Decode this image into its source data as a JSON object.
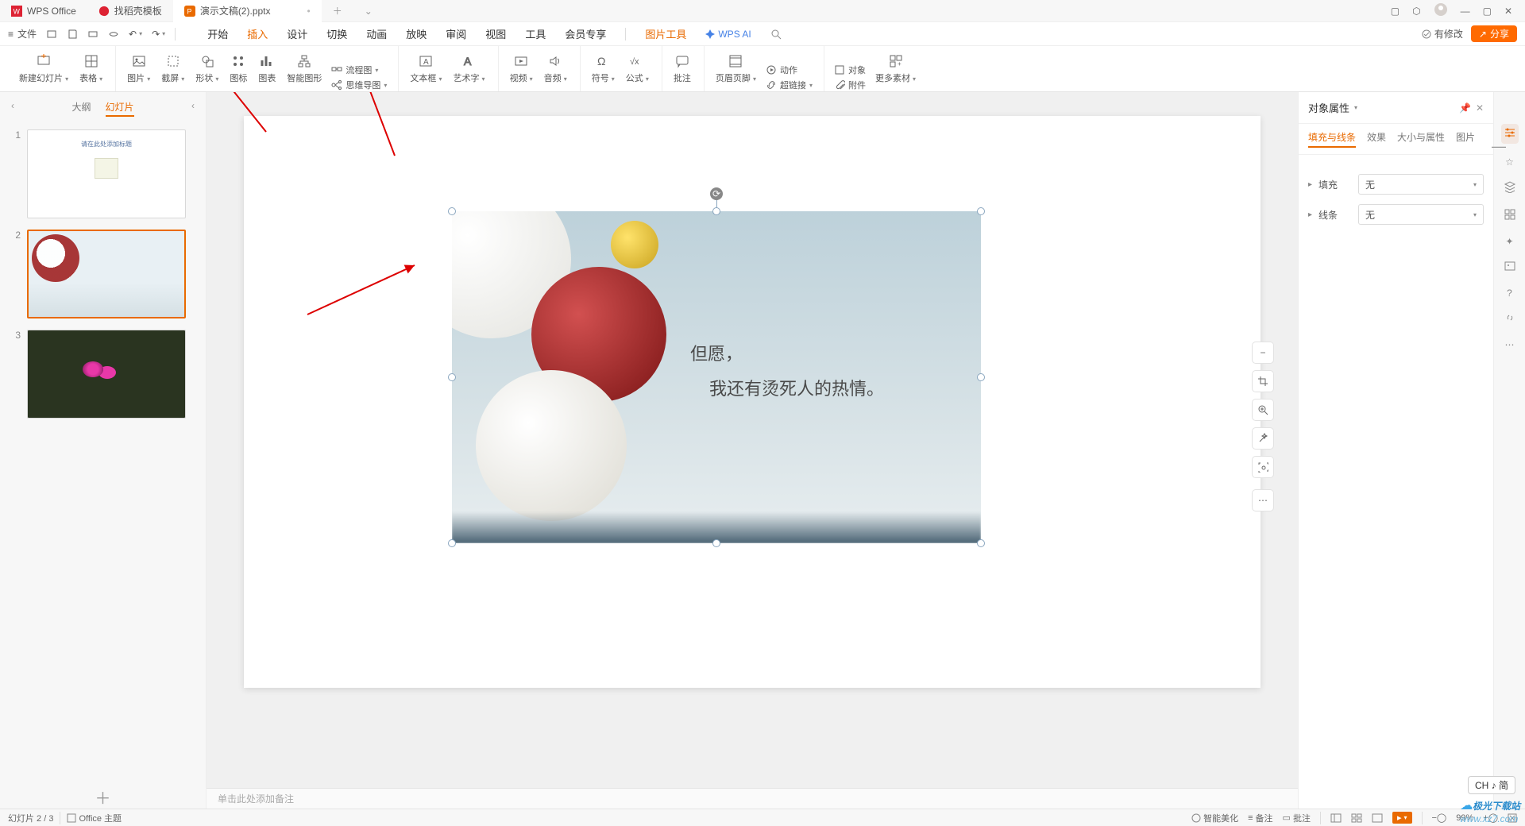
{
  "titlebar": {
    "tabs": [
      {
        "label": "WPS Office",
        "brand": "wps"
      },
      {
        "label": "找稻壳模板",
        "brand": "dao"
      },
      {
        "label": "演示文稿(2).pptx",
        "brand": "ppt",
        "active": true
      }
    ]
  },
  "qtoolbar": {
    "file_label": "文件",
    "right": {
      "changes": "有修改",
      "share": "分享"
    }
  },
  "menubar": {
    "items": [
      "开始",
      "插入",
      "设计",
      "切换",
      "动画",
      "放映",
      "审阅",
      "视图",
      "工具",
      "会员专享"
    ],
    "active_index": 1,
    "extra": "图片工具",
    "ai": "WPS AI"
  },
  "ribbon": {
    "btns": [
      "新建幻灯片",
      "表格",
      "图片",
      "截屏",
      "形状",
      "图标",
      "图表",
      "智能图形",
      "流程图",
      "思维导图",
      "文本框",
      "艺术字",
      "视频",
      "音频",
      "符号",
      "公式",
      "批注",
      "页眉页脚",
      "超链接",
      "动作",
      "对象",
      "附件",
      "更多素材"
    ]
  },
  "outline": {
    "tabs": [
      "大纲",
      "幻灯片"
    ],
    "active": 1,
    "thumb1_text": "请在此处添加标题"
  },
  "slide": {
    "quote_l1": "但愿，",
    "quote_l2": "我还有烫死人的热情。"
  },
  "props": {
    "title": "对象属性",
    "tabs": [
      "填充与线条",
      "效果",
      "大小与属性",
      "图片"
    ],
    "row1_label": "填充",
    "row2_label": "线条",
    "select_none": "无"
  },
  "notes_placeholder": "单击此处添加备注",
  "statusbar": {
    "left": "幻灯片 2 / 3",
    "theme_label": "Office 主题",
    "right": [
      "智能美化",
      "备注",
      "批注"
    ],
    "zoom": "99%"
  },
  "ch_badge": "CH ♪ 简",
  "watermark": {
    "a": "极光下载站",
    "b": "www.xz7.com"
  }
}
